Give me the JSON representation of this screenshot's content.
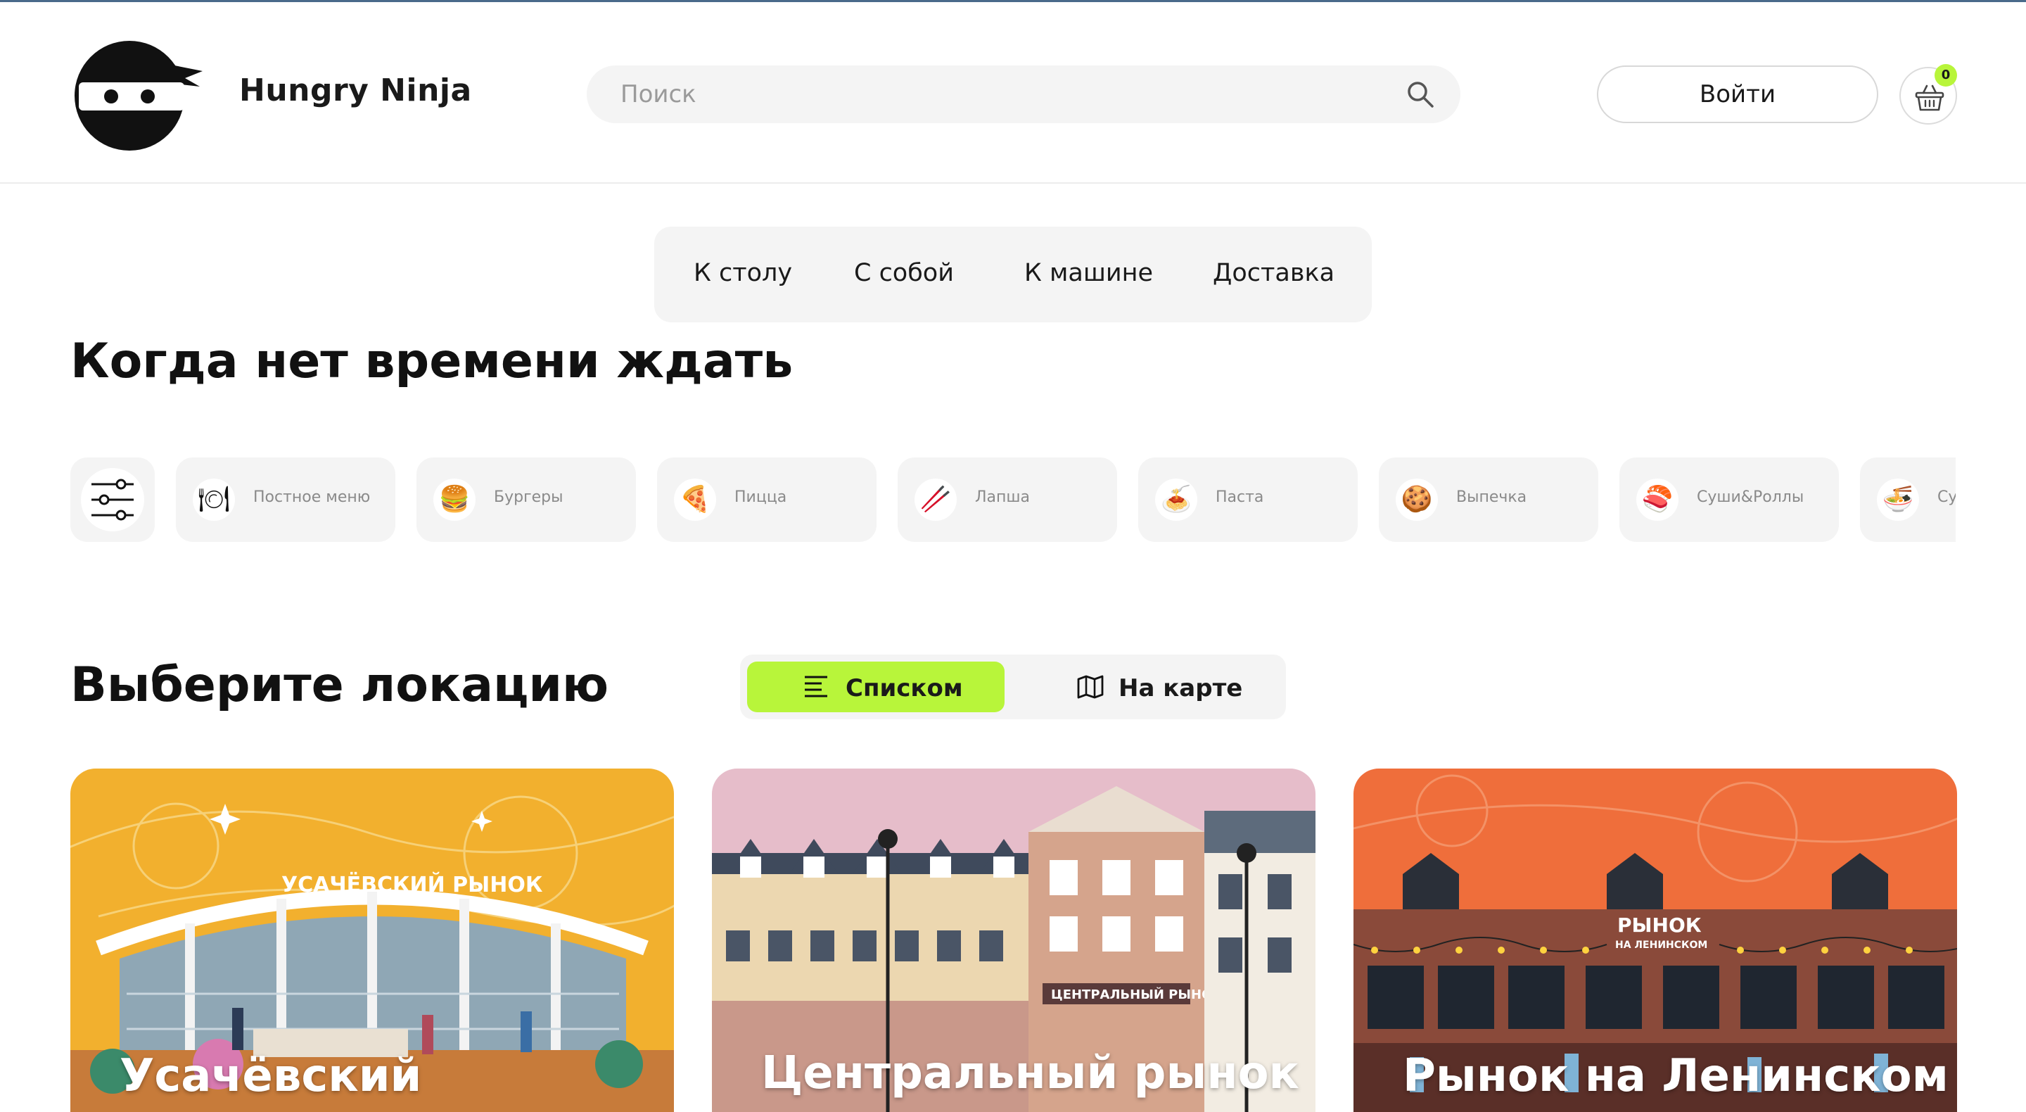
{
  "header": {
    "brand": "Hungry Ninja",
    "search": {
      "placeholder": "Поиск"
    },
    "login_label": "Войти",
    "cart_count": "0"
  },
  "mode_tabs": [
    {
      "label": "К столу"
    },
    {
      "label": "С собой"
    },
    {
      "label": "К машине"
    },
    {
      "label": "Доставка"
    }
  ],
  "section_fast": {
    "title": "Когда нет времени ждать"
  },
  "categories": [
    {
      "label": "Постное меню",
      "icon": "plate-icon"
    },
    {
      "label": "Бургеры",
      "icon": "burger-icon"
    },
    {
      "label": "Пицца",
      "icon": "pizza-icon"
    },
    {
      "label": "Лапша",
      "icon": "chopsticks-icon"
    },
    {
      "label": "Паста",
      "icon": "pasta-icon"
    },
    {
      "label": "Выпечка",
      "icon": "cookie-icon"
    },
    {
      "label": "Суши&Роллы",
      "icon": "sushi-icon"
    },
    {
      "label": "Су",
      "icon": "soup-icon"
    }
  ],
  "section_location": {
    "title": "Выберите локацию",
    "view_list_label": "Списком",
    "view_map_label": "На карте"
  },
  "locations": [
    {
      "sign": "УСАЧЁВСКИЙ РЫНОК",
      "title": "Усачёвский",
      "accent": "#f2b02e"
    },
    {
      "sign": "ЦЕНТРАЛЬНЫЙ РЫНОК",
      "title": "Центральный рынок",
      "accent": "#e6bdca"
    },
    {
      "sign": "РЫНОК",
      "sign2": "НА ЛЕНИНСКОМ",
      "title": "Рынок на Ленинском",
      "accent": "#ef6e3b"
    }
  ],
  "colors": {
    "accent": "#b8f53a",
    "surface": "#f4f4f4",
    "text": "#111111"
  }
}
